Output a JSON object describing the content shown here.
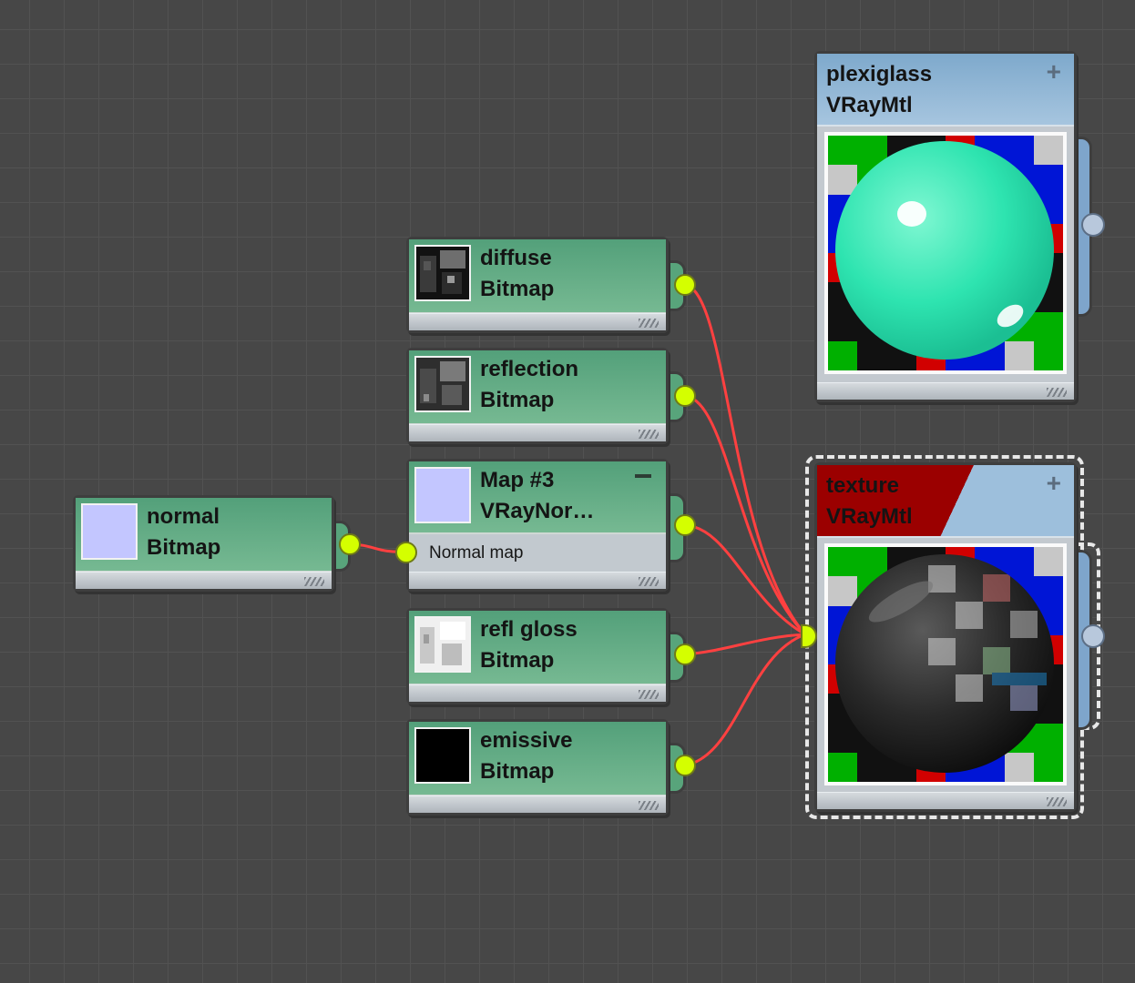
{
  "colors": {
    "canvas": "#474747",
    "map_node": "#5fa982",
    "material_header": "#8ab2d4",
    "port": "#d4ff00",
    "wire": "#ff3b3b",
    "texture_header_accent": "#9b0000"
  },
  "nodes": {
    "normal": {
      "title": "normal",
      "subtitle": "Bitmap"
    },
    "diffuse": {
      "title": "diffuse",
      "subtitle": "Bitmap"
    },
    "reflection": {
      "title": "reflection",
      "subtitle": "Bitmap"
    },
    "normal_map": {
      "title": "Map #3",
      "subtitle": "VRayNor…",
      "slot_label": "Normal map"
    },
    "refl_gloss": {
      "title": "refl gloss",
      "subtitle": "Bitmap"
    },
    "emissive": {
      "title": "emissive",
      "subtitle": "Bitmap"
    }
  },
  "materials": {
    "plexiglass": {
      "name": "plexiglass",
      "type": "VRayMtl"
    },
    "texture": {
      "name": "texture",
      "type": "VRayMtl"
    }
  },
  "icons": {
    "expand": "+",
    "collapse": "—"
  }
}
